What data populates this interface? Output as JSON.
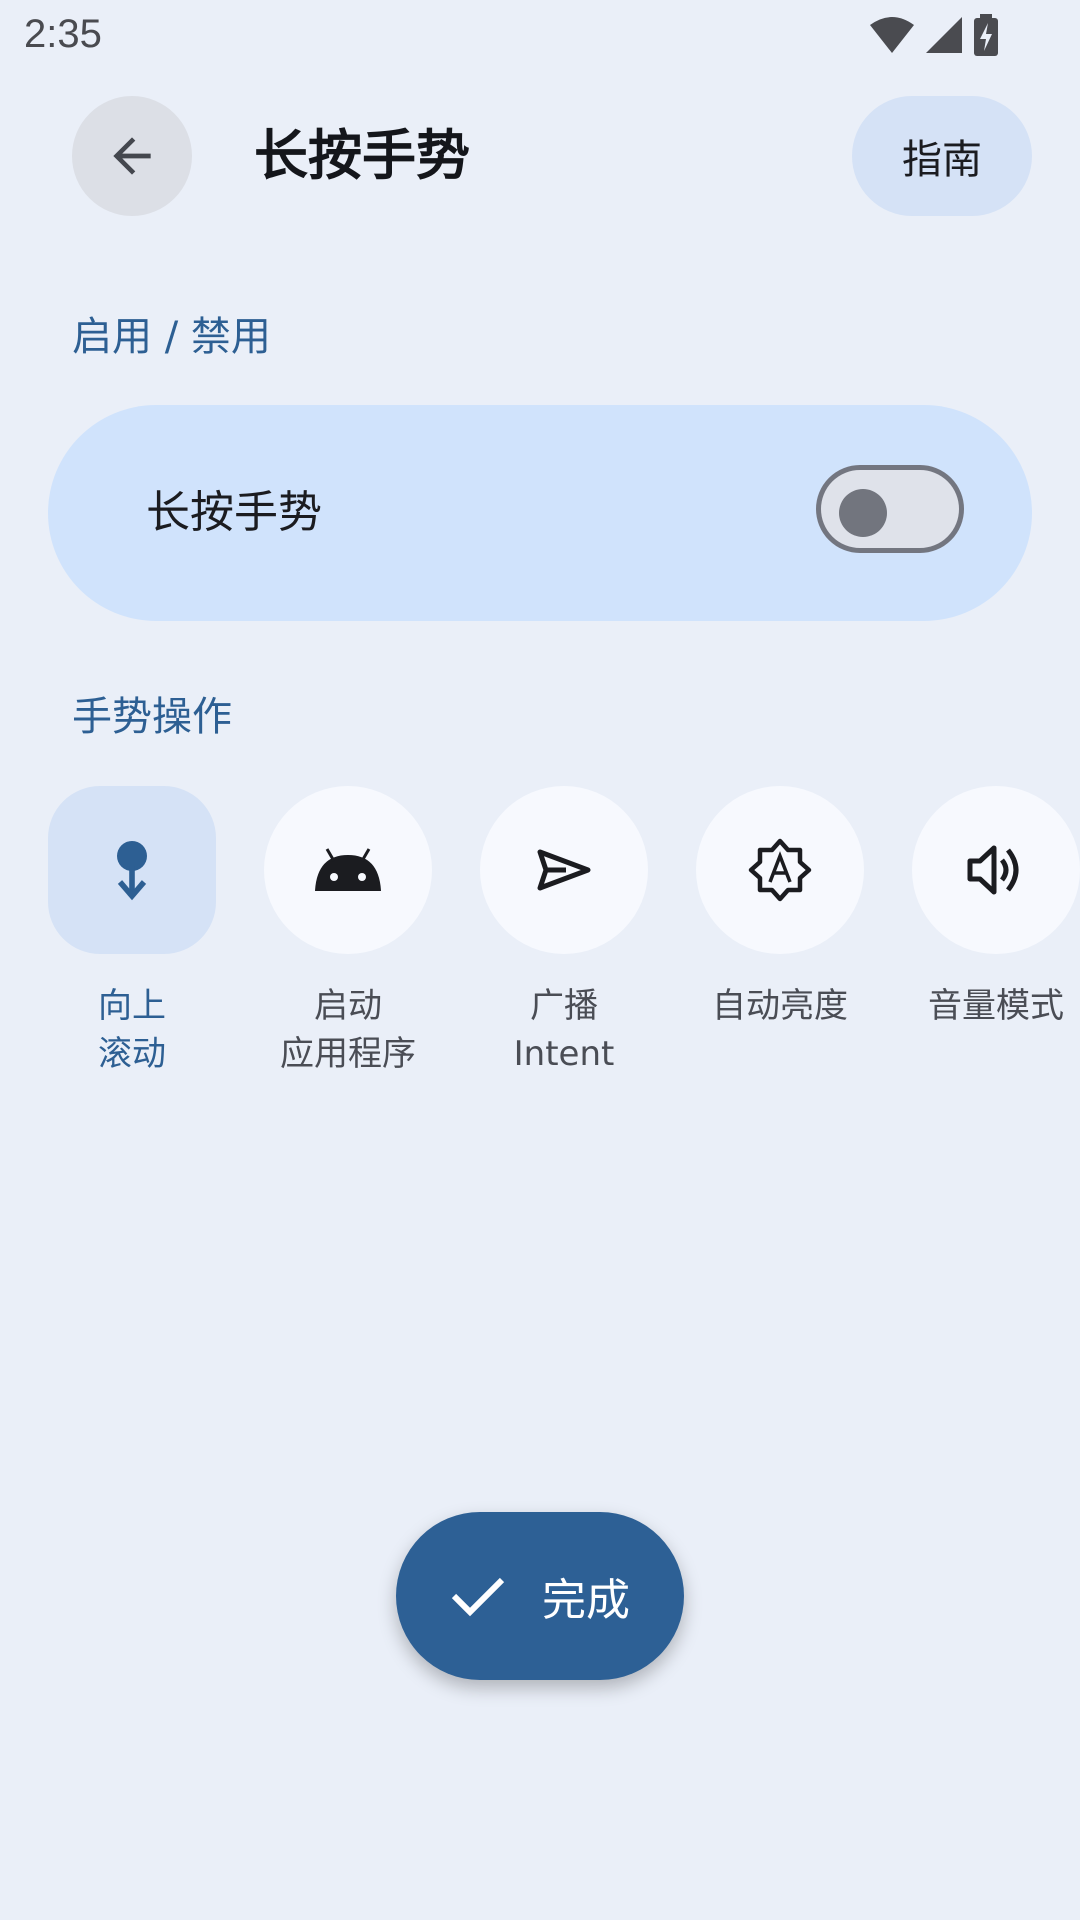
{
  "status_bar": {
    "time": "2:35"
  },
  "header": {
    "title": "长按手势",
    "guide_label": "指南",
    "back_icon": "arrow-back-icon"
  },
  "sections": {
    "enable_label": "启用 / 禁用",
    "actions_label": "手势操作"
  },
  "toggle_card": {
    "label": "长按手势",
    "enabled": false
  },
  "actions": [
    {
      "line1": "向上",
      "line2": "滚动",
      "icon": "scroll-up-icon",
      "selected": true
    },
    {
      "line1": "启动",
      "line2": "应用程序",
      "icon": "android-icon",
      "selected": false
    },
    {
      "line1": "广播",
      "line2": "Intent",
      "icon": "send-icon",
      "selected": false
    },
    {
      "line1": "自动亮度",
      "line2": "",
      "icon": "brightness-auto-icon",
      "selected": false
    },
    {
      "line1": "音量模式",
      "line2": "",
      "icon": "volume-icon",
      "selected": false
    }
  ],
  "fab": {
    "label": "完成",
    "icon": "check-icon"
  },
  "colors": {
    "background": "#EAEFF8",
    "primary": "#2D6095",
    "card": "#D0E3FC",
    "chip": "#D5E2F6"
  }
}
